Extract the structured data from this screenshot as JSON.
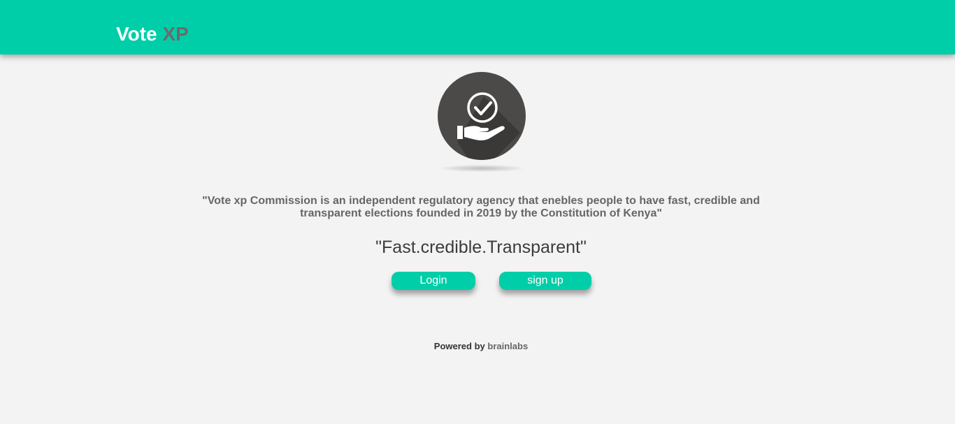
{
  "header": {
    "brand_main": "Vote",
    "brand_accent": "XP",
    "background_color": "#00cea8"
  },
  "hero": {
    "logo_icon": "hand-with-checkmark-icon",
    "description": "\"Vote xp Commission is an independent regulatory agency that enebles people to have fast, credible and transparent elections founded in 2019 by the Constitution of Kenya\"",
    "tagline": "\"Fast.credible.Transparent\""
  },
  "actions": {
    "login_label": "Login",
    "signup_label": "sign up",
    "button_color": "#00cea8"
  },
  "footer": {
    "powered_by": "Powered by",
    "company": "brainlabs"
  }
}
